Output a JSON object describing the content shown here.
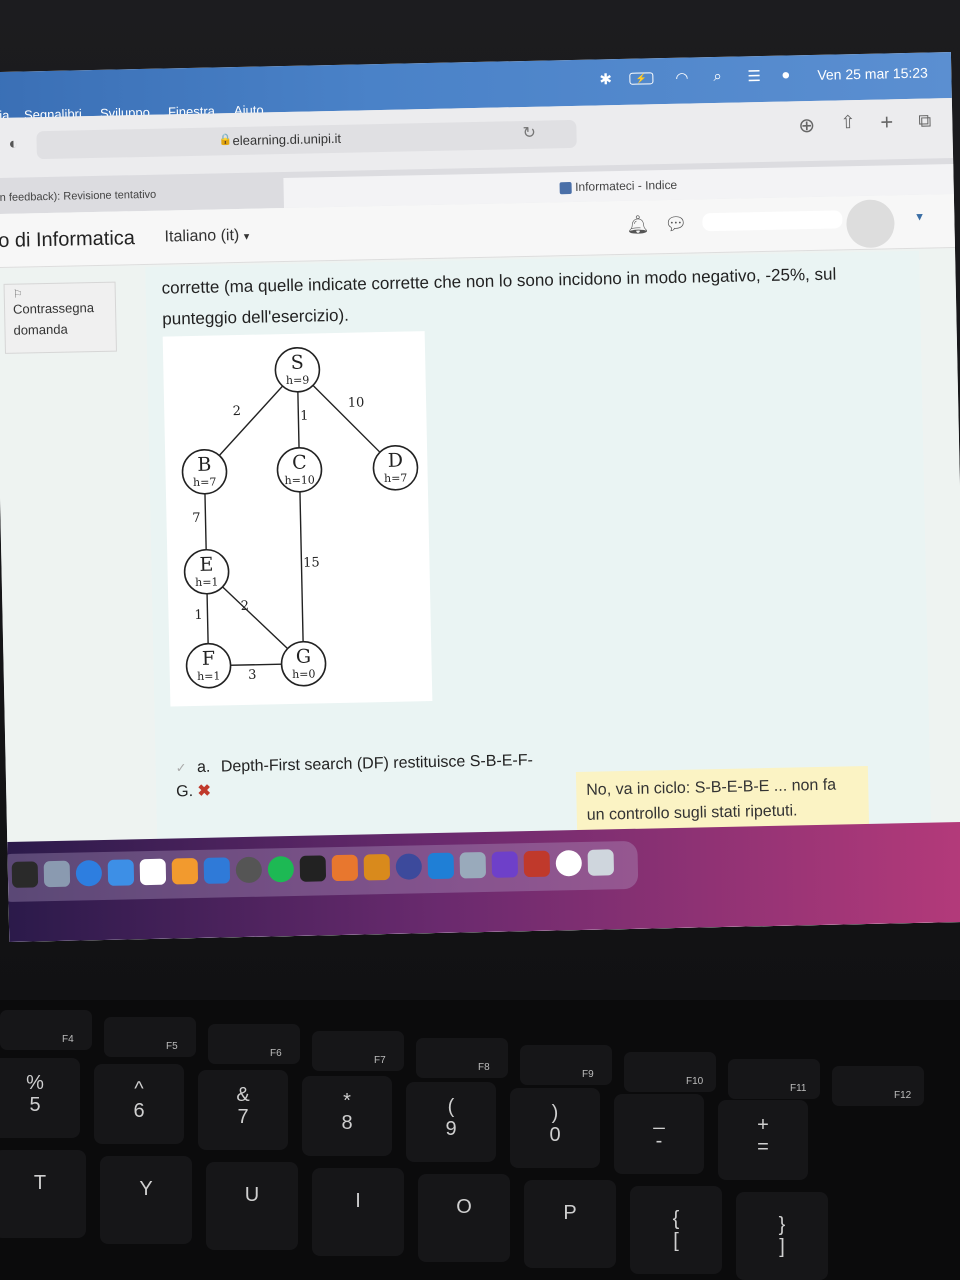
{
  "menubar": {
    "items": [
      "gia",
      "Segnalibri",
      "Sviluppo",
      "Finestra",
      "Aiuto"
    ],
    "datetime": "Ven 25 mar  15:23"
  },
  "browser": {
    "url": "elearning.di.unipi.it",
    "tabs": [
      "n feedback): Revisione tentativo",
      "Informateci - Indice"
    ]
  },
  "page": {
    "site_title": "to di Informatica",
    "language": "Italiano (it)",
    "flag_label": "Contrassegna domanda",
    "question_text": "corrette (ma quelle indicate corrette che non lo sono incidono in modo negativo, -25%,  sul punteggio dell'esercizio).",
    "answer": {
      "letter": "a.",
      "text": "Depth-First search (DF) restituisce S-B-E-F-G.",
      "feedback": "No, va in ciclo: S-B-E-B-E ... non fa un controllo sugli stati ripetuti."
    }
  },
  "graph": {
    "nodes": [
      {
        "id": "S",
        "h": "h=9"
      },
      {
        "id": "B",
        "h": "h=7"
      },
      {
        "id": "C",
        "h": "h=10"
      },
      {
        "id": "D",
        "h": "h=7"
      },
      {
        "id": "E",
        "h": "h=1"
      },
      {
        "id": "F",
        "h": "h=1"
      },
      {
        "id": "G",
        "h": "h=0"
      }
    ],
    "edges": [
      {
        "from": "S",
        "to": "B",
        "w": "2"
      },
      {
        "from": "S",
        "to": "C",
        "w": "1"
      },
      {
        "from": "S",
        "to": "D",
        "w": "10"
      },
      {
        "from": "B",
        "to": "E",
        "w": "7"
      },
      {
        "from": "C",
        "to": "G",
        "w": "15"
      },
      {
        "from": "E",
        "to": "F",
        "w": "1"
      },
      {
        "from": "E",
        "to": "G",
        "w": "2"
      },
      {
        "from": "F",
        "to": "G",
        "w": "3"
      }
    ]
  },
  "keyboard": {
    "fkeys": [
      "F4",
      "F5",
      "F6",
      "F7",
      "F8",
      "F9",
      "F10",
      "F11",
      "F12"
    ],
    "row1": [
      "%\n5",
      "^\n6",
      "&\n7",
      "*\n8",
      "(\n9",
      ")\n0",
      "_\n-",
      "+\n="
    ],
    "row2": [
      "T",
      "Y",
      "U",
      "I",
      "O",
      "P",
      "{\n[",
      "}\n]"
    ]
  }
}
